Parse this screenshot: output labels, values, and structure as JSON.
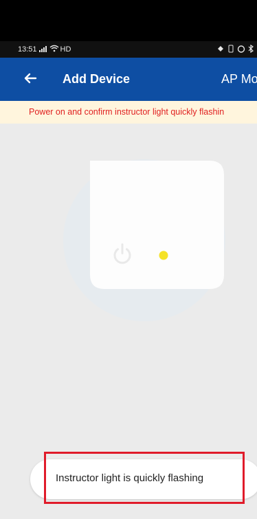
{
  "status_bar": {
    "time": "13:51",
    "signal": "℡ıl",
    "wifi_label": "HD",
    "right_icons": "✲ ◎ ◉ ✳"
  },
  "app_bar": {
    "title": "Add Device",
    "mode_label": "AP Mo"
  },
  "banner": {
    "text": "Power on and confirm instructor light quickly flashin"
  },
  "bottom": {
    "button_label": "Instructor light is quickly flashing"
  },
  "colors": {
    "app_bar": "#0e4ea3",
    "banner_bg": "#fff5dd",
    "banner_text": "#e02020",
    "indicator_light": "#f5e228",
    "highlight_box": "#e01b2a"
  }
}
